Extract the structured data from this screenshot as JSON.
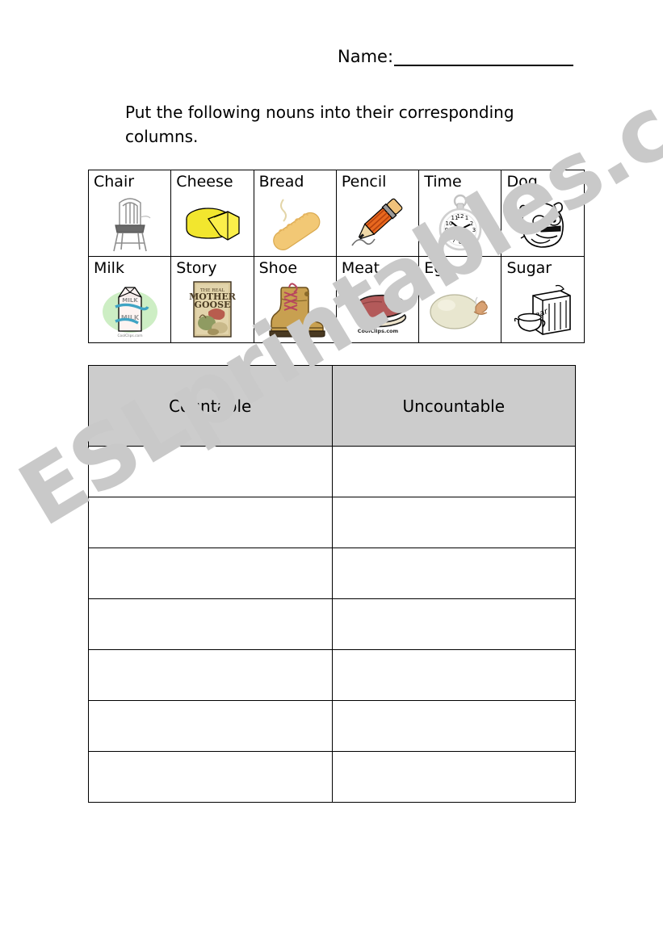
{
  "header": {
    "name_label": "Name:",
    "name_value": ""
  },
  "instructions": {
    "text": "Put the following nouns into their corresponding columns."
  },
  "word_bank": {
    "rows": [
      [
        {
          "word": "Chair",
          "icon": "chair-icon"
        },
        {
          "word": "Cheese",
          "icon": "cheese-icon"
        },
        {
          "word": "Bread",
          "icon": "bread-icon"
        },
        {
          "word": "Pencil",
          "icon": "pencil-icon"
        },
        {
          "word": "Time",
          "icon": "pocket-watch-icon"
        },
        {
          "word": "Dog",
          "icon": "bulldog-icon"
        }
      ],
      [
        {
          "word": "Milk",
          "icon": "milk-carton-icon"
        },
        {
          "word": "Story",
          "icon": "storybook-icon"
        },
        {
          "word": "Shoe",
          "icon": "boot-icon"
        },
        {
          "word": "Meat",
          "icon": "steak-icon"
        },
        {
          "word": "Egg",
          "icon": "egg-icon"
        },
        {
          "word": "Sugar",
          "icon": "sugar-bag-icon"
        }
      ]
    ]
  },
  "clipart_captions": {
    "milk_carton": "MILK",
    "storybook_line1": "THE REAL",
    "storybook_line2": "MOTHER",
    "storybook_line3": "GOOSE",
    "meat_credit": "CoolClips.com",
    "milk_credit": "CoolClips.com",
    "sugar_bag": "sugar"
  },
  "sort_table": {
    "headers": [
      "Countable",
      "Uncountable"
    ],
    "header_bg": "#cccccc",
    "blank_row_count": 7,
    "rows": [
      [
        "",
        ""
      ],
      [
        "",
        ""
      ],
      [
        "",
        ""
      ],
      [
        "",
        ""
      ],
      [
        "",
        ""
      ],
      [
        "",
        ""
      ],
      [
        "",
        ""
      ]
    ]
  },
  "watermark": {
    "text": "ESLprintables.com",
    "color": "#c9c9c9"
  }
}
